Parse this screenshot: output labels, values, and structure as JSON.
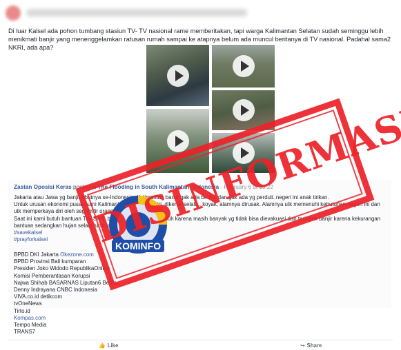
{
  "post": {
    "text": "Di luar Kalsel ada pohon tumbang stasiun TV- TV nasional rame memberitakan, tapi warga Kalimantan Selatan sudah seminggu lebih menikmati banjir yang menenggelamkan ratusan rumah sampai ke atapnya belum ada muncul beritanya di TV nasional. Padahal sama2 NKRI, ada apa?"
  },
  "shared": {
    "author": "Zastan Oposisi Keras",
    "action": "posted in",
    "group": "The Flooding in South Kalimantan, Indonesia",
    "time": "February 6 at 10:22",
    "lines": [
      "Jakarta atau Jawa yg banjir ributnya se-Indonesia, Kalimantan banjir gak ada berita. dan gak ada yg perduli..negeri ini anak tirikan.",
      "Untuk urusan ekonomi pusat bumi Kalimantan kayak anak tiri, dikeruk selalu.. koyak, alamnya dirusak. Alamnya utk memenuhi kebutuhan negeri ini dan utk memperkaya diri oleh segelintir orang2",
      "Saat ini kami butuh bantuan Tim SAR, bantuan evakuasi diri puluh karena masih banyak yg tidak bisa dievakuasi dan terjebak banjir karena kekurangan bantuan sedangkan hujan selalu turun dengan deras"
    ],
    "hashtags": [
      "#savekalsel",
      "#prayforkalsel"
    ]
  },
  "media_list": [
    {
      "text": "BPBD DKI Jakarta",
      "link": "Okezone.com"
    },
    {
      "text": "BPBD Provinsi Bali kumparan",
      "link": ""
    },
    {
      "text": "Presiden Joko Widodo RepublikaOnline",
      "link": ""
    },
    {
      "text": "Komisi Pemberantasan Korupsi",
      "link": ""
    },
    {
      "text": "Najwa Shihab BASARNAS Liputan6 Berita",
      "link": ""
    },
    {
      "text": "Denny Indrayana CNBC Indonesia",
      "link": ""
    },
    {
      "text": "VIVA.co.id detikcom",
      "link": ""
    },
    {
      "text": "tvOneNews",
      "link": ""
    },
    {
      "text": "Tirto.id",
      "link": ""
    },
    {
      "text": "",
      "link": "Kompas.com"
    },
    {
      "text": "Tempo Media",
      "link": ""
    },
    {
      "text": "TRANS7",
      "link": ""
    }
  ],
  "stamp": {
    "text": "DISINFORMASI",
    "color": "#ec2228"
  },
  "logo": {
    "text": "KOMINFO",
    "color": "#1e4ea8"
  },
  "footer": {
    "like": "Like",
    "share": "Share"
  },
  "icons": {
    "play": "play-icon",
    "like": "thumbs-up-icon",
    "share": "share-arrow-icon"
  }
}
